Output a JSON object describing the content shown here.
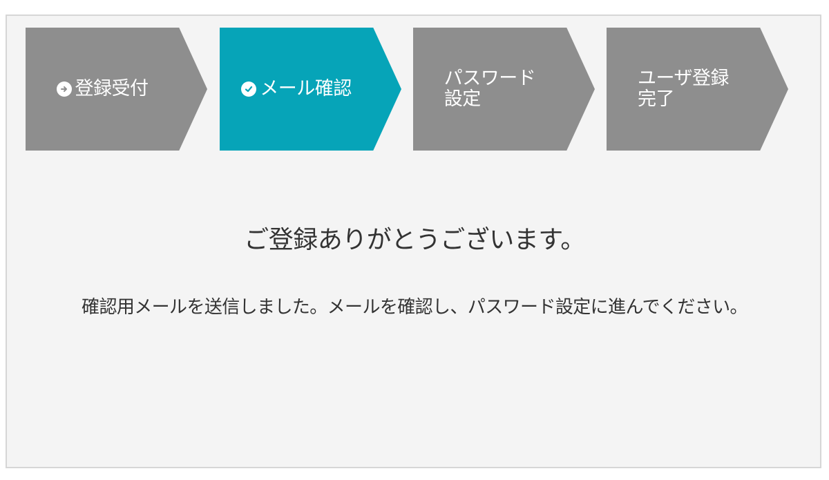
{
  "steps": [
    {
      "label": "登録受付",
      "icon": "arrow-right-circle-icon",
      "active": false
    },
    {
      "label": "メール確認",
      "icon": "check-circle-icon",
      "active": true
    },
    {
      "label": "パスワード\n設定",
      "active": false
    },
    {
      "label": "ユーザ登録\n完了",
      "active": false
    }
  ],
  "main": {
    "title": "ご登録ありがとうございます。",
    "message": "確認用メールを送信しました。メールを確認し、パスワード設定に進んでください。"
  },
  "colors": {
    "active_step": "#06a4b8",
    "inactive_step": "#8e8e8e",
    "panel_bg": "#f4f4f4"
  }
}
